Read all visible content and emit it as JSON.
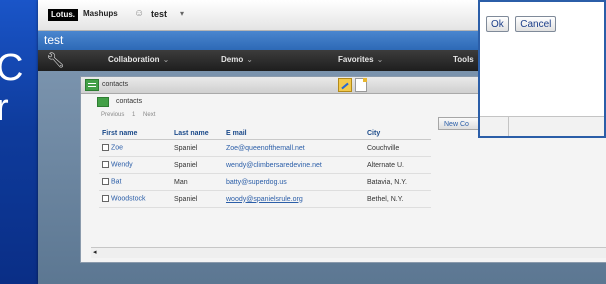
{
  "slide": {
    "bg_text_line1": "C",
    "bg_text_line2": "r"
  },
  "top_bar": {
    "logo": "Lotus.",
    "product": "Mashups",
    "space_name": "test",
    "space_chevron": "▾"
  },
  "page_title": "test",
  "menu": {
    "items": [
      {
        "label": "Collaboration",
        "chevron": "⌄"
      },
      {
        "label": "Demo",
        "chevron": "⌄"
      },
      {
        "label": "Favorites",
        "chevron": "⌄"
      },
      {
        "label": "Tools"
      }
    ]
  },
  "widget": {
    "title": "contacts",
    "view_title": "contacts",
    "pager": {
      "previous": "Previous",
      "page": "1",
      "next": "Next"
    },
    "new_button": "New Co",
    "columns": [
      "First name",
      "Last name",
      "E mail",
      "City"
    ],
    "rows": [
      {
        "first": "Zoe",
        "last": "Spaniel",
        "email": "Zoe@queenofthemall.net",
        "city": "Couchville"
      },
      {
        "first": "Wendy",
        "last": "Spaniel",
        "email": "wendy@climbersaredevine.net",
        "city": "Alternate U."
      },
      {
        "first": "Bat",
        "last": "Man",
        "email": "batty@superdog.us",
        "city": "Batavia, N.Y."
      },
      {
        "first": "Woodstock",
        "last": "Spaniel",
        "email": "woody@spanielsrule.org",
        "city": "Bethel, N.Y."
      }
    ],
    "scroll_left": "◂",
    "scroll_right": "▸"
  },
  "dialog": {
    "ok": "Ok",
    "cancel": "Cancel"
  },
  "icons": {
    "user": "user-icon",
    "wrench": "wrench-icon",
    "list": "list-icon",
    "edit": "edit-icon",
    "page": "page-icon"
  },
  "colors": {
    "accent": "#2b5ea8",
    "title_bar": "#3a78c4",
    "menu_bar": "#2a2a2a",
    "bg_slide": "#1245ac"
  }
}
